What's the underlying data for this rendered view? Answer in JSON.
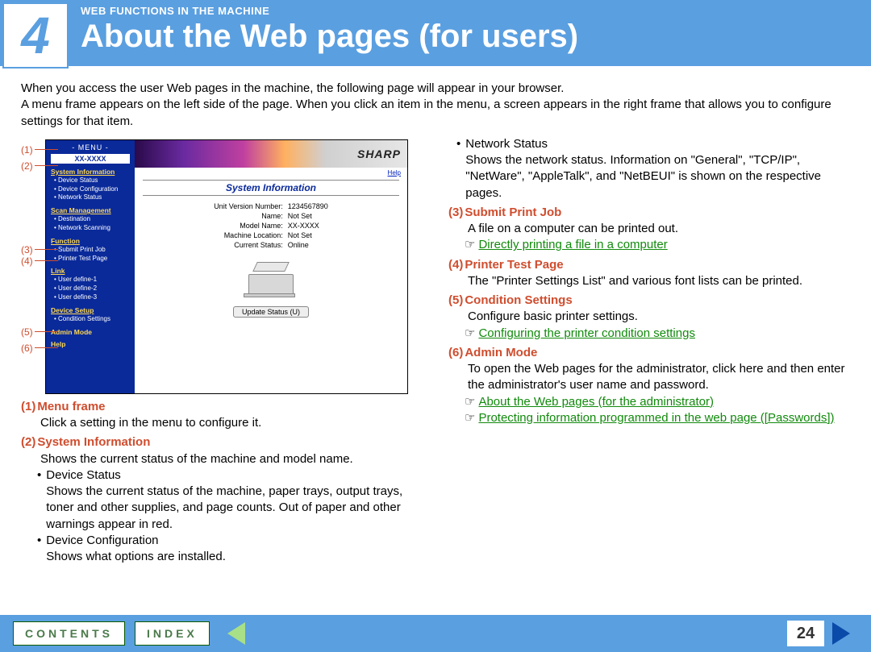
{
  "header": {
    "chapter_number": "4",
    "section_label": "WEB FUNCTIONS IN THE MACHINE",
    "title": "About the Web pages (for users)"
  },
  "intro": "When you access the user Web pages in the machine, the following page will appear in your browser.\nA menu frame appears on the left side of the page. When you click an item in the menu, a screen appears in the right frame that allows you to configure settings for that item.",
  "callouts": [
    "(1)",
    "(2)",
    "(3)",
    "(4)",
    "(5)",
    "(6)"
  ],
  "mini": {
    "menu_label": "- MENU -",
    "model": "XX-XXXX",
    "groups": [
      {
        "head": "System Information",
        "items": [
          "Device Status",
          "Device Configuration",
          "Network Status"
        ]
      },
      {
        "head": "Scan Management",
        "items": [
          "Destination",
          "Network Scanning"
        ]
      },
      {
        "head": "Function",
        "items": [
          "Submit Print Job",
          "Printer Test Page"
        ]
      },
      {
        "head": "Link",
        "items": [
          "User define-1",
          "User define-2",
          "User define-3"
        ]
      },
      {
        "head": "Device Setup",
        "items": [
          "Condition Settings"
        ]
      },
      {
        "head": "Admin Mode",
        "items": []
      },
      {
        "head": "Help",
        "items": []
      }
    ],
    "brand": "SHARP",
    "help": "Help",
    "panel_title": "System Information",
    "info": [
      [
        "Unit Version Number:",
        "1234567890"
      ],
      [
        "Name:",
        "Not Set"
      ],
      [
        "Model Name:",
        "XX-XXXX"
      ],
      [
        "Machine Location:",
        "Not Set"
      ],
      [
        "Current Status:",
        "Online"
      ]
    ],
    "update_btn": "Update Status (U)"
  },
  "defs_left": [
    {
      "num": "(1)",
      "title": "Menu frame",
      "body": "Click a setting in the menu to configure it."
    },
    {
      "num": "(2)",
      "title": "System Information",
      "body": "Shows the current status of the machine and model name.",
      "bullets": [
        {
          "t": "Device Status",
          "d": "Shows the current status of the machine, paper trays, output trays, toner and other supplies, and page counts. Out of paper and other warnings appear in red."
        },
        {
          "t": "Device Configuration",
          "d": "Shows what options are installed."
        }
      ]
    }
  ],
  "defs_right_pre": {
    "t": "Network Status",
    "d": "Shows the network status. Information on \"General\", \"TCP/IP\", \"NetWare\", \"AppleTalk\", and \"NetBEUI\" is shown on the respective pages."
  },
  "defs_right": [
    {
      "num": "(3)",
      "title": "Submit Print Job",
      "body": "A file on a computer can be printed out.",
      "links": [
        "Directly printing a file in a computer"
      ]
    },
    {
      "num": "(4)",
      "title": "Printer Test Page",
      "body": "The \"Printer Settings List\" and various font lists can be printed."
    },
    {
      "num": "(5)",
      "title": "Condition Settings",
      "body": "Configure basic printer settings.",
      "links": [
        "Configuring the printer condition settings"
      ]
    },
    {
      "num": "(6)",
      "title": "Admin Mode",
      "body": "To open the Web pages for the administrator, click here and then enter the administrator's user name and password.",
      "links": [
        "About the Web pages (for the administrator)",
        "Protecting information programmed in the web page ([Passwords])"
      ]
    }
  ],
  "footer": {
    "contents": "CONTENTS",
    "index": "INDEX",
    "page": "24"
  }
}
